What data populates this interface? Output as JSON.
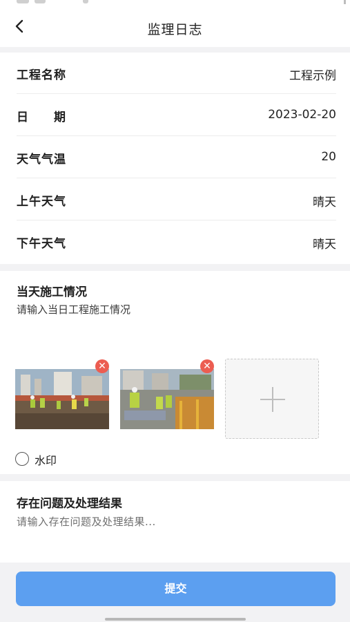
{
  "nav": {
    "title": "监理日志",
    "back_icon": "chevron-left-icon"
  },
  "info_rows": [
    {
      "label": "工程名称",
      "value": "工程示例"
    },
    {
      "label": "日　　期",
      "value": "2023-02-20"
    },
    {
      "label": "天气气温",
      "value": "20"
    },
    {
      "label": "上午天气",
      "value": "晴天"
    },
    {
      "label": "下午天气",
      "value": "晴天"
    }
  ],
  "construction": {
    "title": "当天施工情况",
    "placeholder": "请输入当日工程施工情况",
    "photos": [
      {
        "icon": "construction-site-photo",
        "delete_icon": "close-icon"
      },
      {
        "icon": "construction-site-photo",
        "delete_icon": "close-icon"
      }
    ],
    "add_icon": "plus-icon",
    "watermark_label": "水印",
    "watermark_checked": false
  },
  "issues": {
    "title": "存在问题及处理结果",
    "placeholder": "请输入存在问题及处理结果..."
  },
  "submit_label": "提交",
  "colors": {
    "primary": "#5c9ff0",
    "delete": "#ec5d51",
    "background": "#f2f2f4"
  }
}
